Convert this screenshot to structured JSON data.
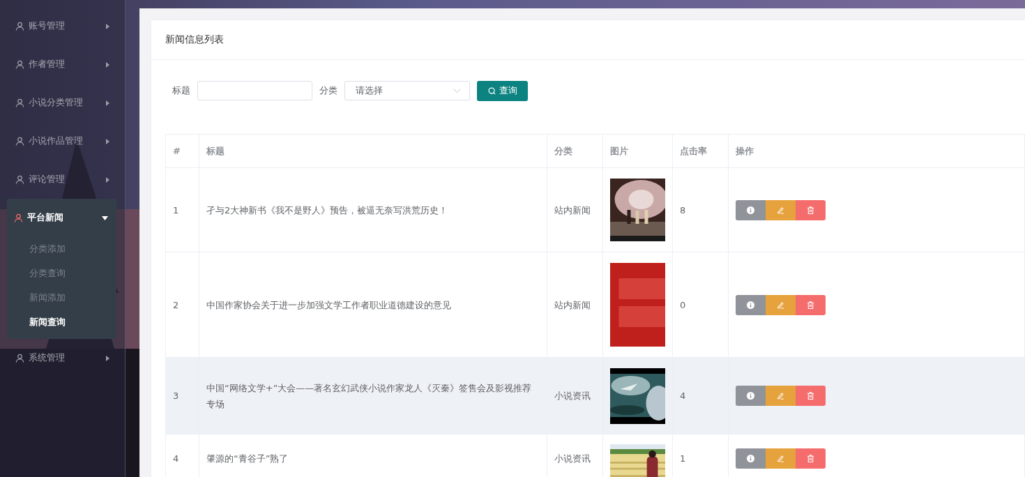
{
  "sidebar": {
    "items": [
      {
        "label": "账号管理",
        "expanded": false,
        "selected": false
      },
      {
        "label": "作者管理",
        "expanded": false,
        "selected": false
      },
      {
        "label": "小说分类管理",
        "expanded": false,
        "selected": false
      },
      {
        "label": "小说作品管理",
        "expanded": false,
        "selected": false
      },
      {
        "label": "评论管理",
        "expanded": false,
        "selected": false
      },
      {
        "label": "平台新闻",
        "expanded": true,
        "selected": true,
        "children": [
          {
            "label": "分类添加",
            "selected": false
          },
          {
            "label": "分类查询",
            "selected": false
          },
          {
            "label": "新闻添加",
            "selected": false
          },
          {
            "label": "新闻查询",
            "selected": true
          }
        ]
      },
      {
        "label": "系统管理",
        "expanded": false,
        "selected": false
      }
    ]
  },
  "card": {
    "title": "新闻信息列表"
  },
  "filters": {
    "title_label": "标题",
    "category_label": "分类",
    "category_select": {
      "placeholder": "请选择"
    },
    "search_button": "查询"
  },
  "table": {
    "columns": [
      "#",
      "标题",
      "分类",
      "图片",
      "点击率",
      "操作"
    ],
    "rows": [
      {
        "index": "1",
        "title": "孑与2大神新书《我不是野人》预告，被逼无奈写洪荒历史！",
        "category": "站内新闻",
        "clicks": "8",
        "hovered": false
      },
      {
        "index": "2",
        "title": "中国作家协会关于进一步加强文学工作者职业道德建设的意见",
        "category": "站内新闻",
        "clicks": "0",
        "hovered": false
      },
      {
        "index": "3",
        "title": "中国“网络文学+”大会——著名玄幻武侠小说作家龙人《灭秦》签售会及影视推荐专场",
        "category": "小说资讯",
        "clicks": "4",
        "hovered": true
      },
      {
        "index": "4",
        "title": "肇源的“青谷子”熟了",
        "category": "小说资讯",
        "clicks": "1",
        "hovered": false
      }
    ]
  }
}
